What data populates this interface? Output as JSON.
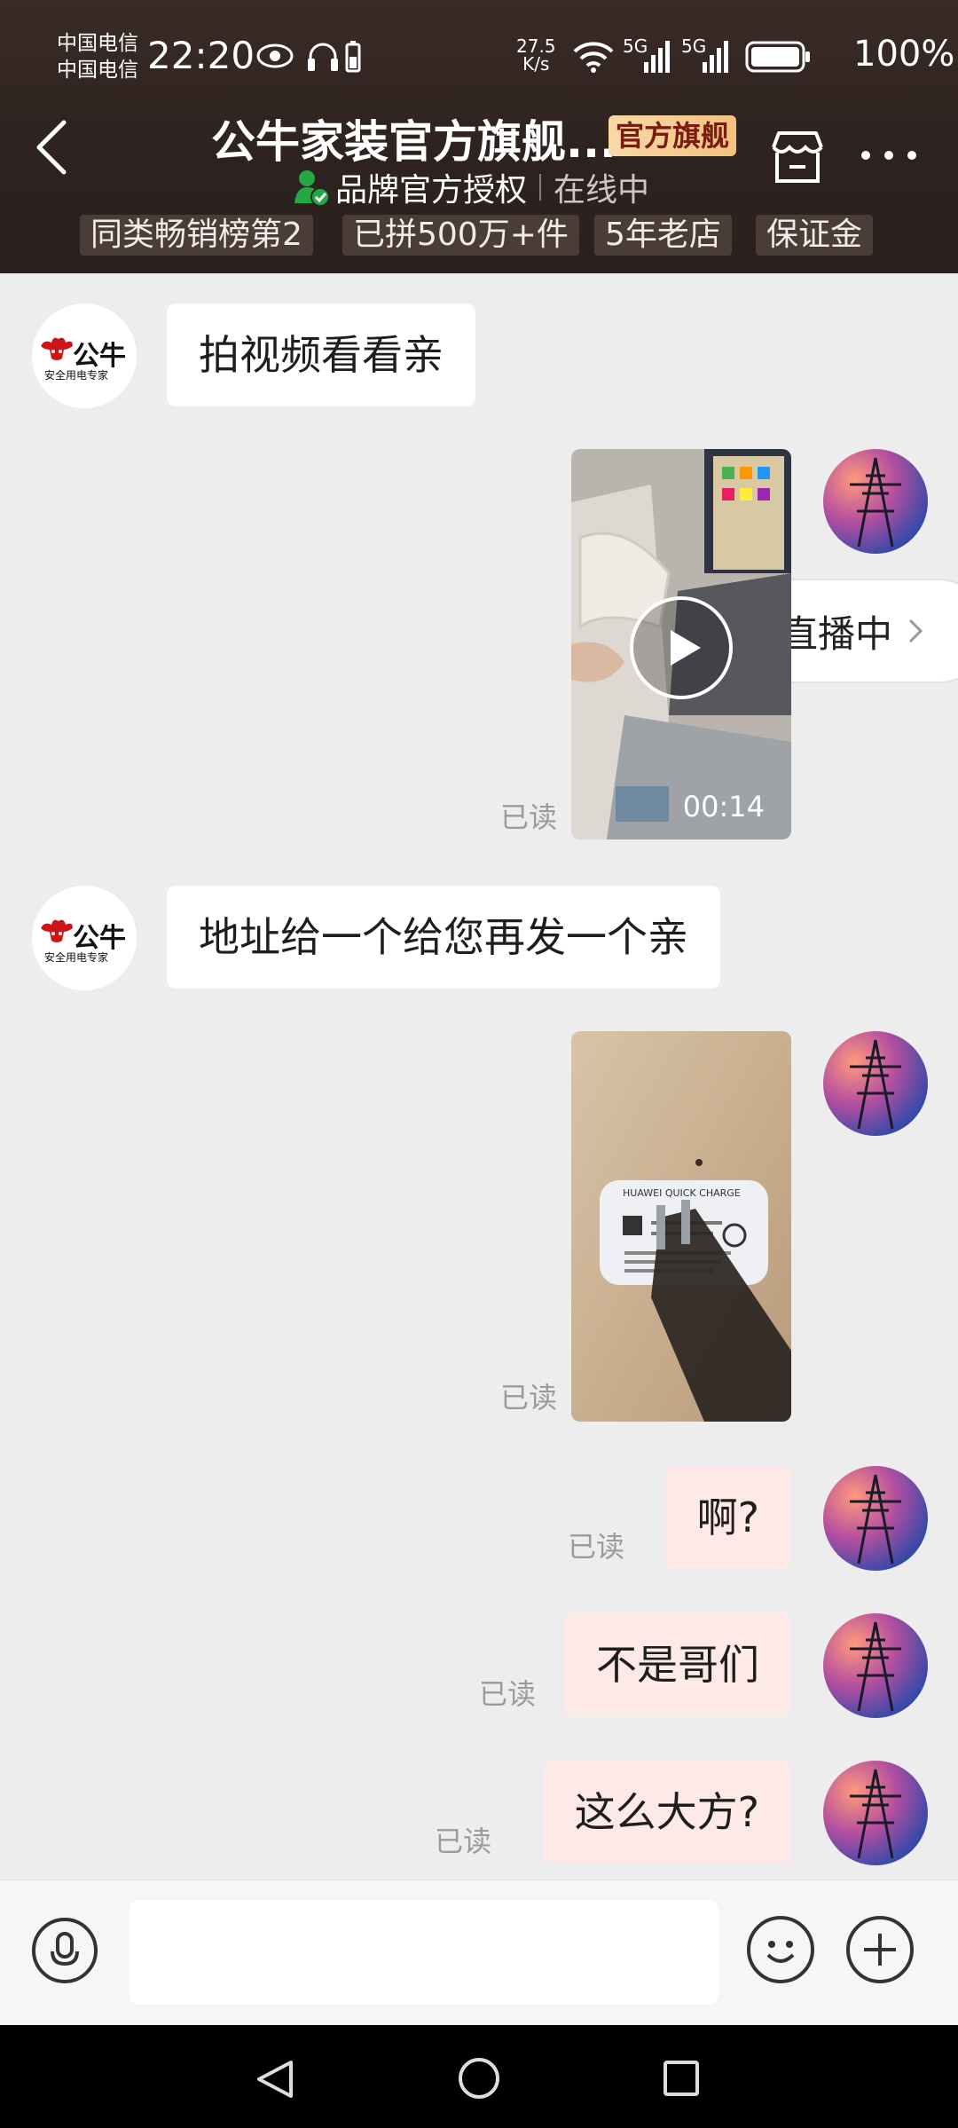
{
  "status_bar": {
    "carrier_1": "中国电信",
    "carrier_2": "中国电信",
    "time": "22:20",
    "net_speed_value": "27.5",
    "net_speed_unit": "K/s",
    "signal_1": "5G",
    "signal_2": "5G",
    "battery": "100%"
  },
  "header": {
    "shop_name": "公牛家装官方旗舰...",
    "badge": "官方旗舰",
    "auth_label": "品牌官方授权",
    "online_status": "在线中",
    "tags": [
      "同类畅销榜第2",
      "已拼500万+件",
      "5年老店",
      "保证金"
    ]
  },
  "brand_logo": {
    "name": "公牛",
    "tagline": "安全用电专家"
  },
  "live_button": {
    "label": "直播中"
  },
  "messages": [
    {
      "from": "shop",
      "text": "拍视频看看亲"
    },
    {
      "from": "user",
      "type": "video",
      "duration": "00:14",
      "read": "已读"
    },
    {
      "from": "shop",
      "text": "地址给一个给您再发一个亲"
    },
    {
      "from": "user",
      "type": "image",
      "read": "已读"
    },
    {
      "from": "user",
      "text": "啊?",
      "read": "已读"
    },
    {
      "from": "user",
      "text": "不是哥们",
      "read": "已读"
    },
    {
      "from": "user",
      "text": "这么大方?",
      "read": "已读"
    }
  ],
  "charger_label": "HUAWEI QUICK CHARGE",
  "colors": {
    "header_bg": "#2d2220",
    "badge_bg": "#f2c17d",
    "user_bubble": "#fde9e6",
    "live_red": "#e8312f"
  }
}
